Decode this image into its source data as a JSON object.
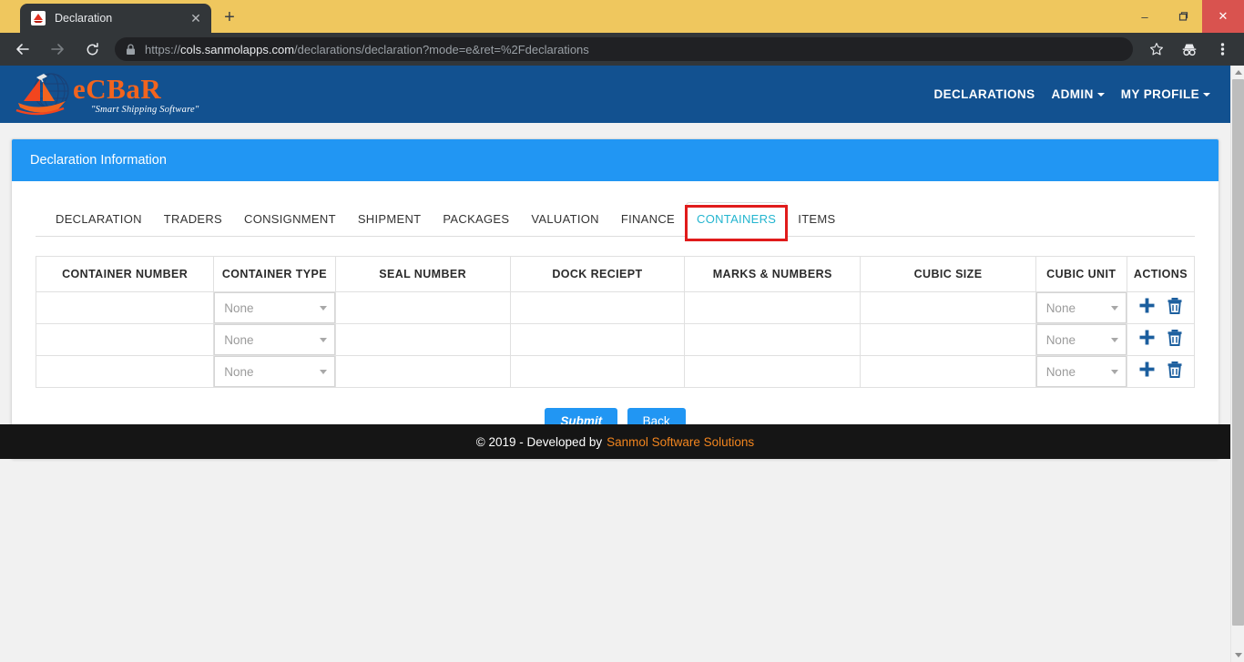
{
  "browser": {
    "tab_title": "Declaration",
    "tab_close_label": "✕",
    "newtab_label": "+",
    "back_icon": "back-arrow-icon",
    "forward_icon": "forward-arrow-icon",
    "reload_icon": "reload-icon",
    "lock_icon": "lock-icon",
    "url_scheme": "https://",
    "url_host": "cols.sanmolapps.com",
    "url_path": "/declarations/declaration?mode=e&ret=%2Fdeclarations",
    "star_icon": "star-icon",
    "incognito_icon": "incognito-icon",
    "menu_icon": "three-dot-menu-icon",
    "minimize_label": "–",
    "maximize_label": "❐",
    "close_label": "✕",
    "titlebar_color": "#efc75e",
    "chrome_color": "#323639",
    "close_button_color": "#d9534f"
  },
  "site": {
    "logo_word": "eCBaR",
    "logo_tagline": "\"Smart Shipping Software\"",
    "brand_color": "#f2641e",
    "navbar_color": "#125190",
    "nav": [
      {
        "label": "DECLARATIONS",
        "has_caret": false
      },
      {
        "label": "ADMIN",
        "has_caret": true
      },
      {
        "label": "MY PROFILE",
        "has_caret": true
      }
    ]
  },
  "panel": {
    "title": "Declaration Information",
    "header_color": "#2196f3"
  },
  "tabs": [
    {
      "label": "DECLARATION",
      "active": false
    },
    {
      "label": "TRADERS",
      "active": false
    },
    {
      "label": "CONSIGNMENT",
      "active": false
    },
    {
      "label": "SHIPMENT",
      "active": false
    },
    {
      "label": "PACKAGES",
      "active": false
    },
    {
      "label": "VALUATION",
      "active": false
    },
    {
      "label": "FINANCE",
      "active": false
    },
    {
      "label": "CONTAINERS",
      "active": true
    },
    {
      "label": "ITEMS",
      "active": false
    }
  ],
  "annotation": {
    "color": "#e01b1b",
    "target": "CONTAINERS"
  },
  "table": {
    "columns": [
      "CONTAINER NUMBER",
      "CONTAINER TYPE",
      "SEAL NUMBER",
      "DOCK RECIEPT",
      "MARKS & NUMBERS",
      "CUBIC SIZE",
      "CUBIC UNIT",
      "ACTIONS"
    ],
    "rows": [
      {
        "container_number": "",
        "container_type": "None",
        "seal_number": "",
        "dock_reciept": "",
        "marks_numbers": "",
        "cubic_size": "",
        "cubic_unit": "None",
        "add_icon": "plus-icon",
        "delete_icon": "trash-icon"
      },
      {
        "container_number": "",
        "container_type": "None",
        "seal_number": "",
        "dock_reciept": "",
        "marks_numbers": "",
        "cubic_size": "",
        "cubic_unit": "None",
        "add_icon": "plus-icon",
        "delete_icon": "trash-icon"
      },
      {
        "container_number": "",
        "container_type": "None",
        "seal_number": "",
        "dock_reciept": "",
        "marks_numbers": "",
        "cubic_size": "",
        "cubic_unit": "None",
        "add_icon": "plus-icon",
        "delete_icon": "trash-icon"
      }
    ]
  },
  "buttons": {
    "submit": "Submit",
    "back": "Back",
    "color": "#2196f3"
  },
  "footer": {
    "copyright": "© 2019 - Developed by",
    "company": "Sanmol Software Solutions",
    "company_color": "#f2851e",
    "background": "#151515"
  }
}
